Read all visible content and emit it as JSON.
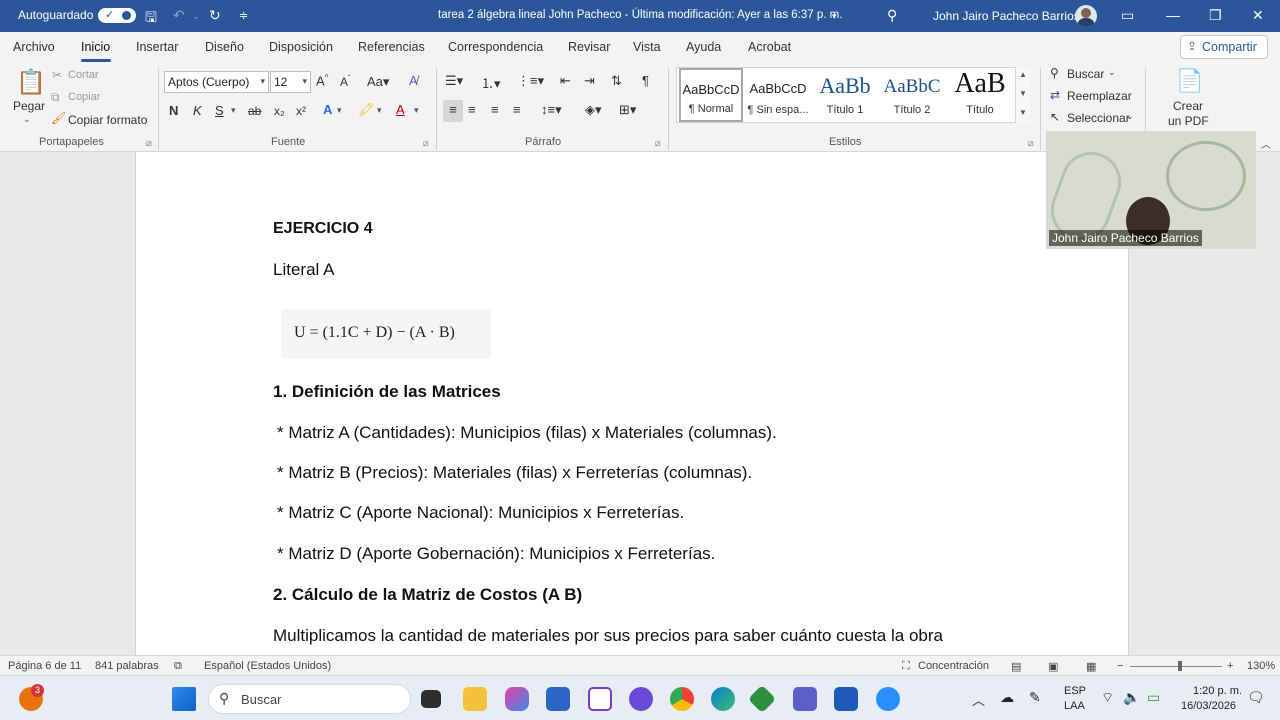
{
  "titlebar": {
    "autosave_label": "Autoguardado",
    "doc_title": "tarea 2 álgebra lineal John Pacheco  -  Última modificación: Ayer a las 6:37 p. m.",
    "user_name": "John Jairo Pacheco Barrios"
  },
  "menu": {
    "items": [
      "Archivo",
      "Inicio",
      "Insertar",
      "Diseño",
      "Disposición",
      "Referencias",
      "Correspondencia",
      "Revisar",
      "Vista",
      "Ayuda",
      "Acrobat"
    ],
    "share": "Compartir"
  },
  "ribbon": {
    "clipboard": {
      "paste": "Pegar",
      "cut": "Cortar",
      "copy": "Copiar",
      "format_painter": "Copiar formato",
      "group": "Portapapeles"
    },
    "font": {
      "name": "Aptos (Cuerpo)",
      "size": "12",
      "bold": "N",
      "italic": "K",
      "underline": "S",
      "strike": "ab",
      "sub": "x₂",
      "sup": "x²",
      "group": "Fuente"
    },
    "paragraph": {
      "group": "Párrafo"
    },
    "styles": {
      "group": "Estilos",
      "tiles": [
        {
          "preview": "AaBbCcD",
          "name": "¶ Normal"
        },
        {
          "preview": "AaBbCcD",
          "name": "¶ Sin espa..."
        },
        {
          "preview": "AaBb",
          "name": "Título 1"
        },
        {
          "preview": "AaBbC",
          "name": "Título 2"
        },
        {
          "preview": "AaB",
          "name": "Título"
        }
      ]
    },
    "editing": {
      "find": "Buscar",
      "replace": "Reemplazar",
      "select": "Seleccionar"
    },
    "pdf": {
      "line1": "Crear",
      "line2": "un PDF"
    }
  },
  "document": {
    "heading": "EJERCICIO 4",
    "literal": "Literal A",
    "equation": "U = (1.1C + D) − (A · B)",
    "section1": "1. Definición de las Matrices",
    "bullets": [
      "* Matriz A (Cantidades): Municipios (filas) x Materiales (columnas).",
      "* Matriz B (Precios): Materiales (filas) x Ferreterías (columnas).",
      "* Matriz C (Aporte Nacional): Municipios x Ferreterías.",
      "* Matriz D (Aporte Gobernación): Municipios x Ferreterías."
    ],
    "section2": "2. Cálculo de la Matriz de Costos (A  B)",
    "paragraph": "Multiplicamos la cantidad de materiales por sus precios para saber cuánto cuesta la obra"
  },
  "webcam": {
    "name": "John Jairo Pacheco Barrios"
  },
  "status": {
    "page": "Página 6 de 11",
    "words": "841 palabras",
    "language": "Español (Estados Unidos)",
    "focus": "Concentración",
    "zoom": "130%"
  },
  "taskbar": {
    "search": "Buscar",
    "notif_count": "3",
    "lang1": "ESP",
    "lang2": "LAA",
    "time": "1:20 p. m.",
    "date": "16/03/2026"
  }
}
